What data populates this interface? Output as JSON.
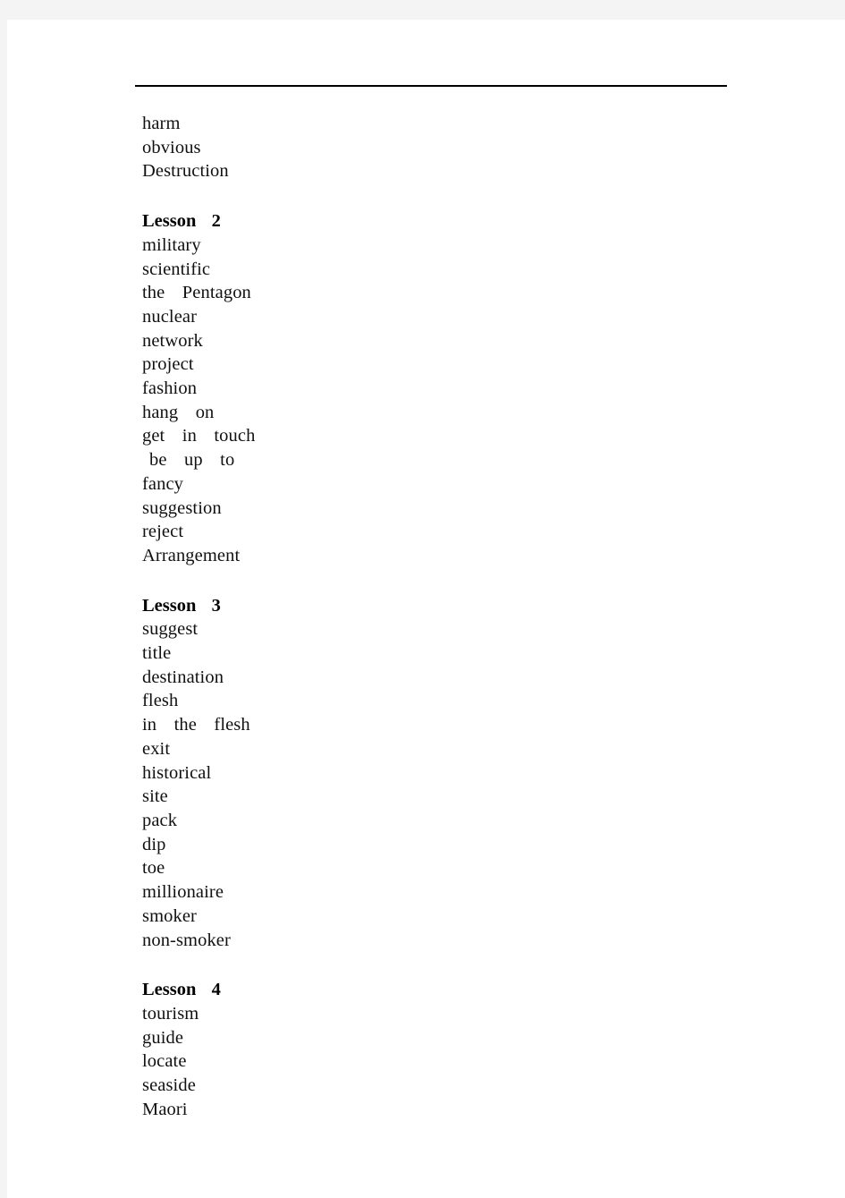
{
  "document": {
    "type": "vocabulary-word-list",
    "page_background": "#f4f4f4",
    "sheet_background": "#ffffff",
    "text_color": "#111111",
    "rule_color": "#000000"
  },
  "sections": [
    {
      "heading": null,
      "words": [
        "harm",
        "obvious",
        "Destruction"
      ]
    },
    {
      "heading": "Lesson  2",
      "words": [
        "military",
        "scientific",
        "the  Pentagon",
        "nuclear",
        "network",
        "project",
        "fashion",
        "hang  on",
        "get  in  touch",
        "be  up  to",
        "fancy",
        "suggestion",
        "reject",
        "Arrangement"
      ]
    },
    {
      "heading": "Lesson  3",
      "words": [
        "suggest",
        "title",
        "destination",
        "flesh",
        "in  the  flesh",
        "exit",
        "historical",
        "site",
        "pack",
        "dip",
        "toe",
        "millionaire",
        "smoker",
        "non-smoker"
      ]
    },
    {
      "heading": "Lesson  4",
      "words": [
        "tourism",
        "guide",
        "locate",
        "seaside",
        "Maori"
      ]
    }
  ]
}
